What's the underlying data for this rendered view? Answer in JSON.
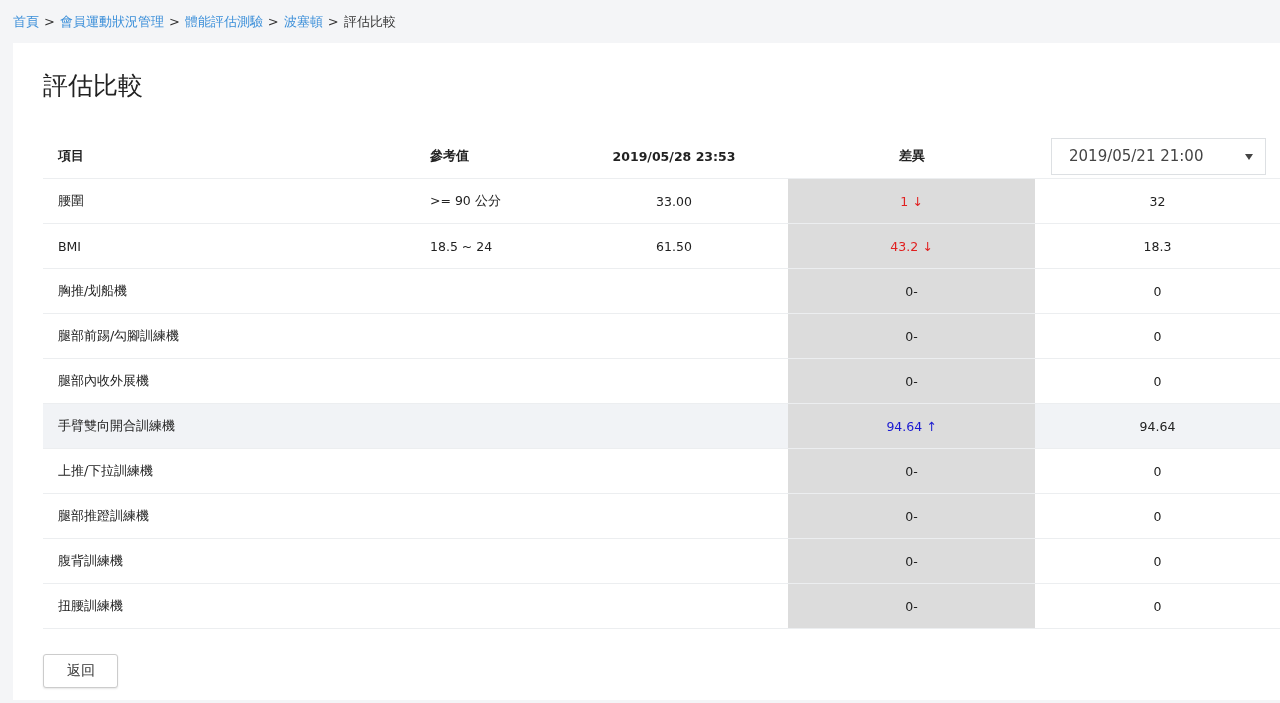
{
  "breadcrumb": [
    {
      "kind": "link",
      "text": "首頁"
    },
    {
      "kind": "separator",
      "text": ">"
    },
    {
      "kind": "link",
      "text": "會員運動狀況管理"
    },
    {
      "kind": "separator",
      "text": ">"
    },
    {
      "kind": "link",
      "text": "體能評估測驗"
    },
    {
      "kind": "separator",
      "text": ">"
    },
    {
      "kind": "link",
      "text": "波塞頓"
    },
    {
      "kind": "separator",
      "text": ">"
    },
    {
      "kind": "current",
      "text": "評估比較"
    }
  ],
  "title": "評估比較",
  "table": {
    "columns": [
      "項目",
      "參考值",
      "2019/05/28 23:53",
      "差異"
    ],
    "compare_select": {
      "value": "2019/05/21 21:00"
    },
    "rows": [
      {
        "item": "腰圍",
        "reference": ">= 90 公分",
        "current": "33.00",
        "difference": "1 ↓",
        "kind": "down",
        "compare": "32",
        "highlighted": false
      },
      {
        "item": "BMI",
        "reference": "18.5 ~ 24",
        "current": "61.50",
        "difference": "43.2 ↓",
        "kind": "down",
        "compare": "18.3",
        "highlighted": false
      },
      {
        "item": "胸推/划船機",
        "difference": "0-",
        "kind": "none",
        "compare": "0",
        "highlighted": false
      },
      {
        "item": "腿部前踢/勾腳訓練機",
        "difference": "0-",
        "kind": "none",
        "compare": "0",
        "highlighted": false
      },
      {
        "item": "腿部內收外展機",
        "difference": "0-",
        "kind": "none",
        "compare": "0",
        "highlighted": false
      },
      {
        "item": "手臂雙向開合訓練機",
        "difference": "94.64 ↑",
        "kind": "up",
        "compare": "94.64",
        "highlighted": true
      },
      {
        "item": "上推/下拉訓練機",
        "difference": "0-",
        "kind": "none",
        "compare": "0",
        "highlighted": false
      },
      {
        "item": "腿部推蹬訓練機",
        "difference": "0-",
        "kind": "none",
        "compare": "0",
        "highlighted": false
      },
      {
        "item": "腹背訓練機",
        "difference": "0-",
        "kind": "none",
        "compare": "0",
        "highlighted": false
      },
      {
        "item": "扭腰訓練機",
        "difference": "0-",
        "kind": "none",
        "compare": "0",
        "highlighted": false
      }
    ]
  },
  "back_button": "返回"
}
